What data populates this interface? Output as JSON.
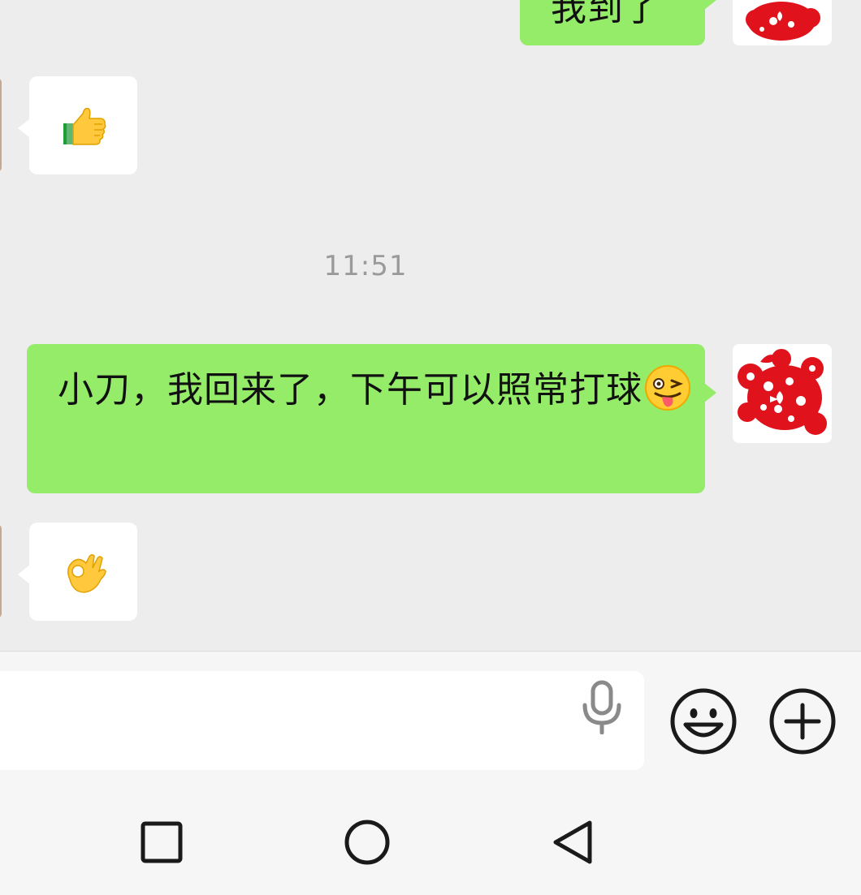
{
  "chat": {
    "messages": [
      {
        "sender": "self",
        "text": "我到了"
      },
      {
        "sender": "other",
        "sticker": "thumbs-up-emoji"
      },
      {
        "sender": "self",
        "text": "小刀，我回来了，下午可以照常打球"
      },
      {
        "sender": "other",
        "sticker": "ok-hand-emoji"
      }
    ],
    "timestamp": "11:51"
  },
  "input_bar": {
    "voice_icon": "microphone-icon",
    "emoji_icon": "smiley-icon",
    "more_icon": "plus-circle-icon"
  },
  "navbar": {
    "recent_icon": "square-icon",
    "home_icon": "circle-icon",
    "back_icon": "triangle-back-icon"
  },
  "colors": {
    "chat_background": "#ededed",
    "self_bubble": "#95ec69",
    "other_bubble": "#ffffff",
    "avatar_papercut": "#e0121b"
  }
}
